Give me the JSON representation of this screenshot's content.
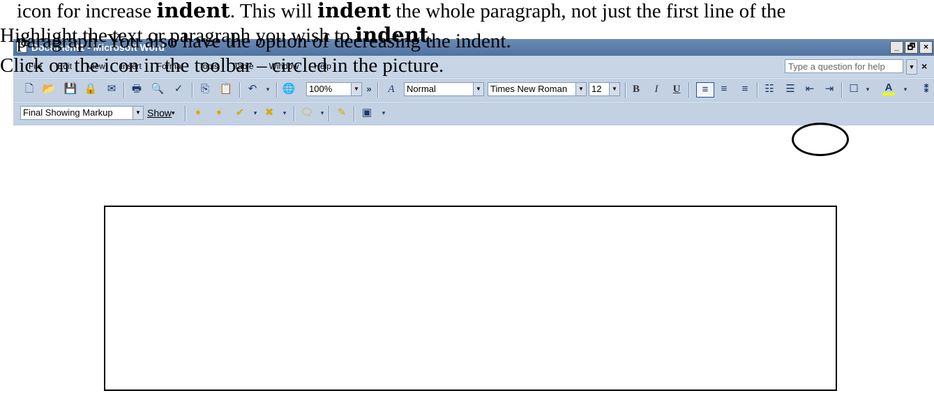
{
  "instructions": {
    "line1_part1": "icon for increase ",
    "line1_bold1": "indent",
    "line1_part2": ". This will ",
    "line1_bold2": "indent",
    "line1_part3": " the whole paragraph, not just the first line of the",
    "line2_part1": "Highlight the text or paragraph you wish to ",
    "line2_bold": "indent",
    "line2_part2": ".",
    "line3": "paragraph. You also have the option of decreasing the indent.",
    "line4": "Click on the icon in the toolbar – circled in the picture."
  },
  "window": {
    "title": "Document1 - Microsoft Word",
    "controls": [
      "_",
      "🗗",
      "×"
    ]
  },
  "menubar": {
    "items": [
      "File",
      "Edit",
      "View",
      "Insert",
      "Format",
      "Tools",
      "Table",
      "Window",
      "Help"
    ],
    "help_placeholder": "Type a question for help",
    "close_label": "×"
  },
  "toolbar": {
    "zoom": "100%",
    "style": "Normal",
    "font": "Times New Roman",
    "size": "12",
    "bold": "B",
    "italic": "I",
    "underline": "U",
    "overflow": "»"
  },
  "reviewing": {
    "display": "Final Showing Markup",
    "show_label": "Show"
  },
  "icons": {
    "new": "new-document-icon",
    "open": "open-folder-icon",
    "save": "save-disk-icon",
    "permission": "permission-icon",
    "email": "email-icon",
    "print": "print-icon",
    "preview": "print-preview-icon",
    "spelling": "spelling-check-icon",
    "copy": "copy-icon",
    "paste": "paste-icon",
    "undo": "undo-icon",
    "hyperlink": "insert-hyperlink-icon",
    "styles": "styles-formatting-icon",
    "align_left": "align-left-icon",
    "center": "center-icon",
    "align_right": "align-right-icon",
    "numbering": "numbering-icon",
    "bullets": "bullets-icon",
    "decrease_indent": "decrease-indent-icon",
    "increase_indent": "increase-indent-icon",
    "border": "outside-border-icon",
    "font_color": "font-color-icon"
  },
  "colors": {
    "accent_yellow": "#f5e600",
    "font_color_bar": "#e8ff00",
    "title_blue": "#4f73a1"
  }
}
